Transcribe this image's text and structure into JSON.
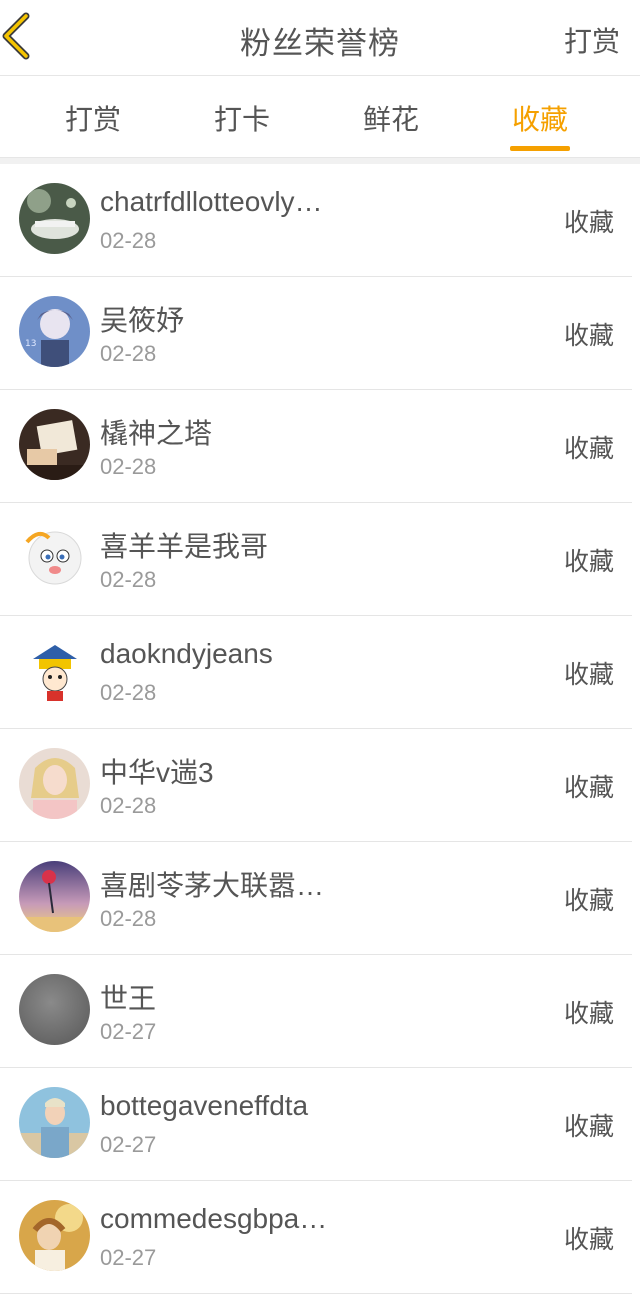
{
  "header": {
    "title": "粉丝荣誉榜",
    "right_action": "打赏",
    "accent": "#f5a000"
  },
  "tabs": [
    {
      "label": "打赏",
      "active": false
    },
    {
      "label": "打卡",
      "active": false
    },
    {
      "label": "鲜花",
      "active": false
    },
    {
      "label": "收藏",
      "active": true
    }
  ],
  "list": [
    {
      "name": "chatrfdllotteovly…",
      "date": "02-28",
      "type": "收藏"
    },
    {
      "name": "吴筱妤",
      "date": "02-28",
      "type": "收藏"
    },
    {
      "name": "橇神之塔",
      "date": "02-28",
      "type": "收藏"
    },
    {
      "name": "喜羊羊是我哥",
      "date": "02-28",
      "type": "收藏"
    },
    {
      "name": "daokndyjeans",
      "date": "02-28",
      "type": "收藏"
    },
    {
      "name": "中华v遄3",
      "date": "02-28",
      "type": "收藏"
    },
    {
      "name": "喜剧苓茅大联嚣…",
      "date": "02-28",
      "type": "收藏"
    },
    {
      "name": "世王",
      "date": "02-27",
      "type": "收藏"
    },
    {
      "name": "bottegaveneffdta",
      "date": "02-27",
      "type": "收藏"
    },
    {
      "name": "commedesgbpa…",
      "date": "02-27",
      "type": "收藏"
    }
  ]
}
